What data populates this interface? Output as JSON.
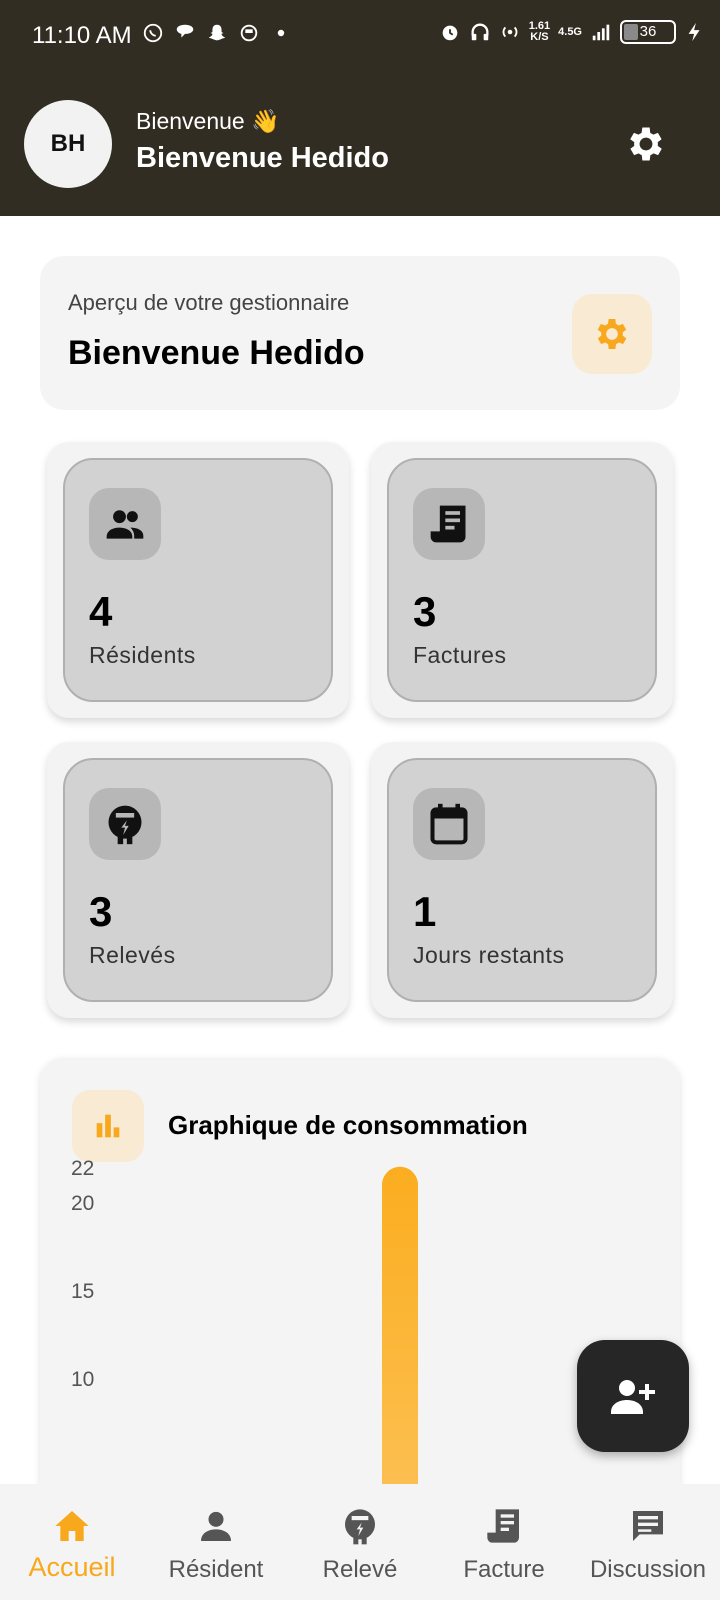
{
  "status_bar": {
    "time": "11:10 AM",
    "net_speed": "1.61",
    "net_speed_unit": "K/S",
    "network_type": "4.5G",
    "battery": "36"
  },
  "header": {
    "avatar_initials": "BH",
    "greeting_small": "Bienvenue 👋",
    "greeting_big": "Bienvenue Hedido"
  },
  "overview": {
    "subtitle": "Aperçu de votre gestionnaire",
    "title": "Bienvenue Hedido"
  },
  "stats": [
    {
      "value": "4",
      "label": "Résidents",
      "icon": "people-icon"
    },
    {
      "value": "3",
      "label": "Factures",
      "icon": "receipt-icon"
    },
    {
      "value": "3",
      "label": "Relevés",
      "icon": "meter-icon"
    },
    {
      "value": "1",
      "label": "Jours restants",
      "icon": "calendar-icon"
    }
  ],
  "chart_section": {
    "title": "Graphique de consommation"
  },
  "chart_data": {
    "type": "bar",
    "title": "Graphique de consommation",
    "xlabel": "",
    "ylabel": "",
    "y_ticks": [
      10,
      15,
      20,
      22
    ],
    "ylim": [
      0,
      22
    ],
    "values": [
      22
    ],
    "grid": false
  },
  "nav": [
    {
      "label": "Accueil",
      "icon": "home-icon",
      "active": true
    },
    {
      "label": "Résident",
      "icon": "person-icon",
      "active": false
    },
    {
      "label": "Relevé",
      "icon": "meter-icon",
      "active": false
    },
    {
      "label": "Facture",
      "icon": "receipt-icon",
      "active": false
    },
    {
      "label": "Discussion",
      "icon": "chat-icon",
      "active": false
    }
  ],
  "colors": {
    "header_bg": "#322d22",
    "accent": "#f7a81d",
    "card_bg": "#f4f4f4",
    "fab_bg": "#262626"
  }
}
